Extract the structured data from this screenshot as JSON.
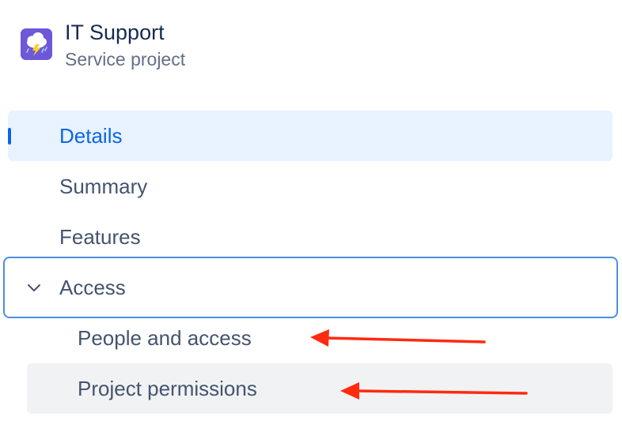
{
  "project": {
    "name": "IT Support",
    "type": "Service project",
    "icon": "storm-cloud-icon"
  },
  "nav": {
    "details": "Details",
    "summary": "Summary",
    "features": "Features",
    "access": "Access",
    "people_and_access": "People and access",
    "project_permissions": "Project permissions"
  },
  "colors": {
    "accent": "#0c66e4",
    "selected_bg": "#e9f2ff",
    "focus_border": "#4c8fe0",
    "annotation_arrow": "#ff2a10",
    "project_icon_bg": "#6e58d8"
  }
}
